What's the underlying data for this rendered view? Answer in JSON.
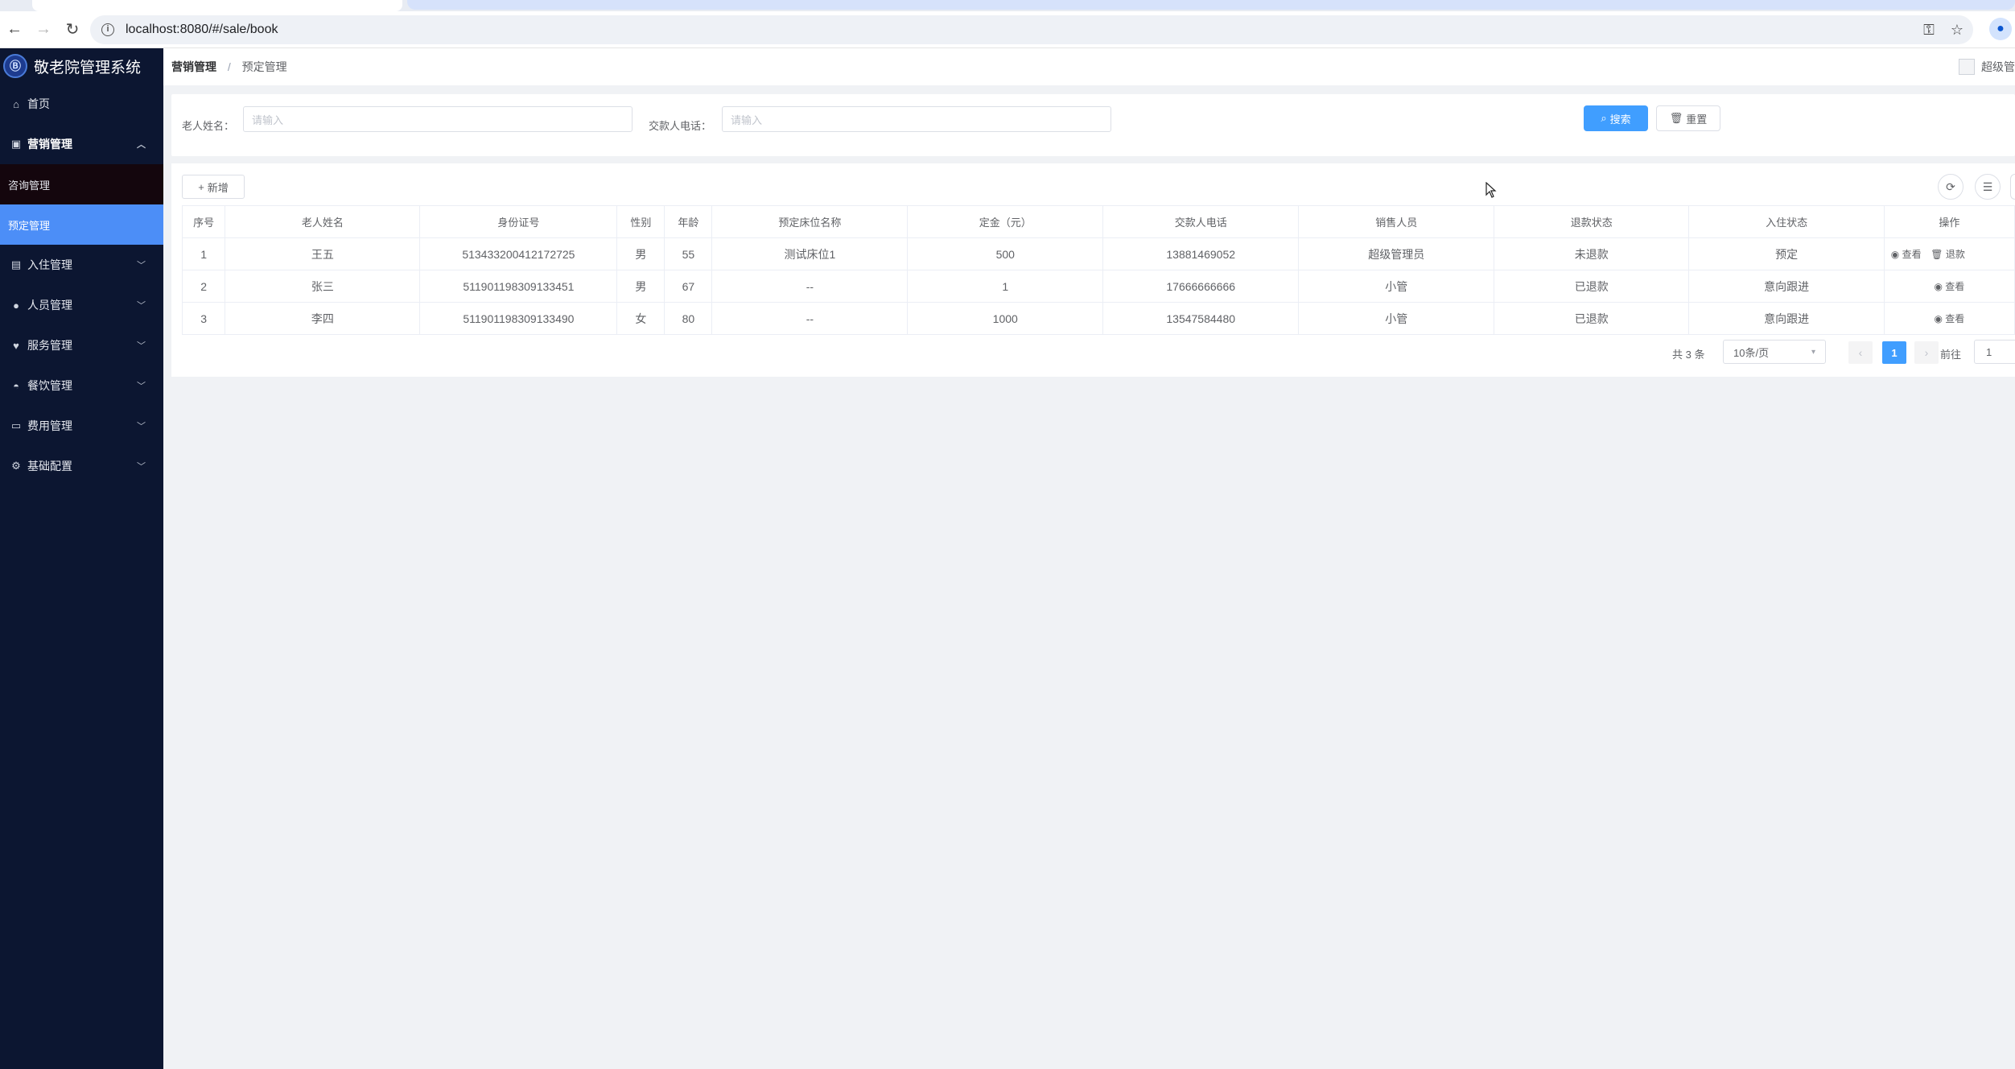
{
  "browser": {
    "url": "localhost:8080/#/sale/book"
  },
  "app": {
    "title": "敬老院管理系统",
    "logo_mark": "Ⓑ"
  },
  "sidebar": {
    "items": [
      {
        "label": "首页",
        "icon": "home-icon"
      },
      {
        "label": "营销管理",
        "icon": "marketing-icon"
      },
      {
        "label": "入住管理",
        "icon": "checkin-icon"
      },
      {
        "label": "人员管理",
        "icon": "person-icon"
      },
      {
        "label": "服务管理",
        "icon": "service-icon"
      },
      {
        "label": "餐饮管理",
        "icon": "dining-icon"
      },
      {
        "label": "费用管理",
        "icon": "fee-icon"
      },
      {
        "label": "基础配置",
        "icon": "gear-icon"
      }
    ],
    "submenu": [
      {
        "label": "咨询管理"
      },
      {
        "label": "预定管理"
      }
    ]
  },
  "breadcrumb": {
    "level1": "营销管理",
    "separator": "/",
    "level2": "预定管理"
  },
  "user": {
    "name": "超级管"
  },
  "search": {
    "elder_name_label": "老人姓名：",
    "elder_name_placeholder": "请输入",
    "payer_phone_label": "交款人电话：",
    "payer_phone_placeholder": "请输入",
    "search_button": "搜索",
    "reset_button": "重置"
  },
  "toolbar": {
    "add_button": "新增"
  },
  "table": {
    "headers": [
      "序号",
      "老人姓名",
      "身份证号",
      "性别",
      "年龄",
      "预定床位名称",
      "定金（元）",
      "交款人电话",
      "销售人员",
      "退款状态",
      "入住状态",
      "操作"
    ],
    "rows": [
      {
        "no": "1",
        "name": "王五",
        "id": "513433200412172725",
        "gender": "男",
        "age": "55",
        "bed": "测试床位1",
        "deposit": "500",
        "phone": "13881469052",
        "sales": "超级管理员",
        "refund": "未退款",
        "status": "预定",
        "action1": "查看",
        "action2": "退款"
      },
      {
        "no": "2",
        "name": "张三",
        "id": "511901198309133451",
        "gender": "男",
        "age": "67",
        "bed": "--",
        "deposit": "1",
        "phone": "17666666666",
        "sales": "小管",
        "refund": "已退款",
        "status": "意向跟进",
        "action1": "查看",
        "action2": ""
      },
      {
        "no": "3",
        "name": "李四",
        "id": "511901198309133490",
        "gender": "女",
        "age": "80",
        "bed": "--",
        "deposit": "1000",
        "phone": "13547584480",
        "sales": "小管",
        "refund": "已退款",
        "status": "意向跟进",
        "action1": "查看",
        "action2": ""
      }
    ]
  },
  "pagination": {
    "total": "共 3 条",
    "page_size": "10条/页",
    "current_page": "1",
    "goto_label": "前往",
    "goto_value": "1"
  },
  "colors": {
    "sidebar_bg": "#0c1631",
    "active_menu": "#4c8ef7",
    "primary": "#409eff"
  }
}
